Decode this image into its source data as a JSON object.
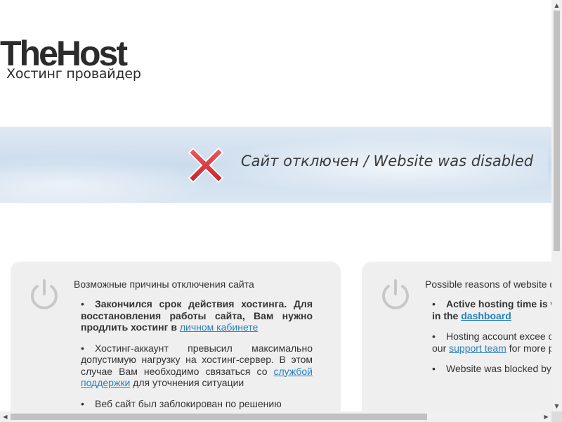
{
  "logo": {
    "main": "TheHost",
    "sub": "Хостинг провайдер"
  },
  "banner": {
    "title": "Сайт отключен / Website was disabled",
    "icon": "red-x-icon"
  },
  "left_card": {
    "title": "Возможные причины отключения сайта",
    "reason1": {
      "text": "Закончился срок действия хостинга. Для восстановления работы сайта, Вам нужно продлить хостинг в ",
      "link": "личном кабинете"
    },
    "reason2": {
      "text_before": "Хостинг-аккаунт превысил максимально допустимую нагрузку на хостинг-сервер. В этом случае Вам необходимо связаться со ",
      "link": "службой поддержки",
      "text_after": " для уточнения ситуации"
    },
    "reason3": {
      "text": "Веб сайт был заблокирован по решению"
    }
  },
  "right_card": {
    "title": "Possible reasons of website d",
    "reason1": {
      "text": "Active hosting time is website work You need to in the ",
      "link": "dashboard"
    },
    "reason2": {
      "text_before": "Hosting account excee on hosting-server. In this c our ",
      "link": "support team",
      "text_after": " for more p"
    },
    "reason3": {
      "text": "Website was blocked by"
    }
  },
  "scrollbars": {
    "up": "▲",
    "down": "▼",
    "left": "◀",
    "right": "▶"
  },
  "colors": {
    "link": "#2a7fc0",
    "card_bg": "#efefef",
    "x_red": "#d9363e"
  }
}
